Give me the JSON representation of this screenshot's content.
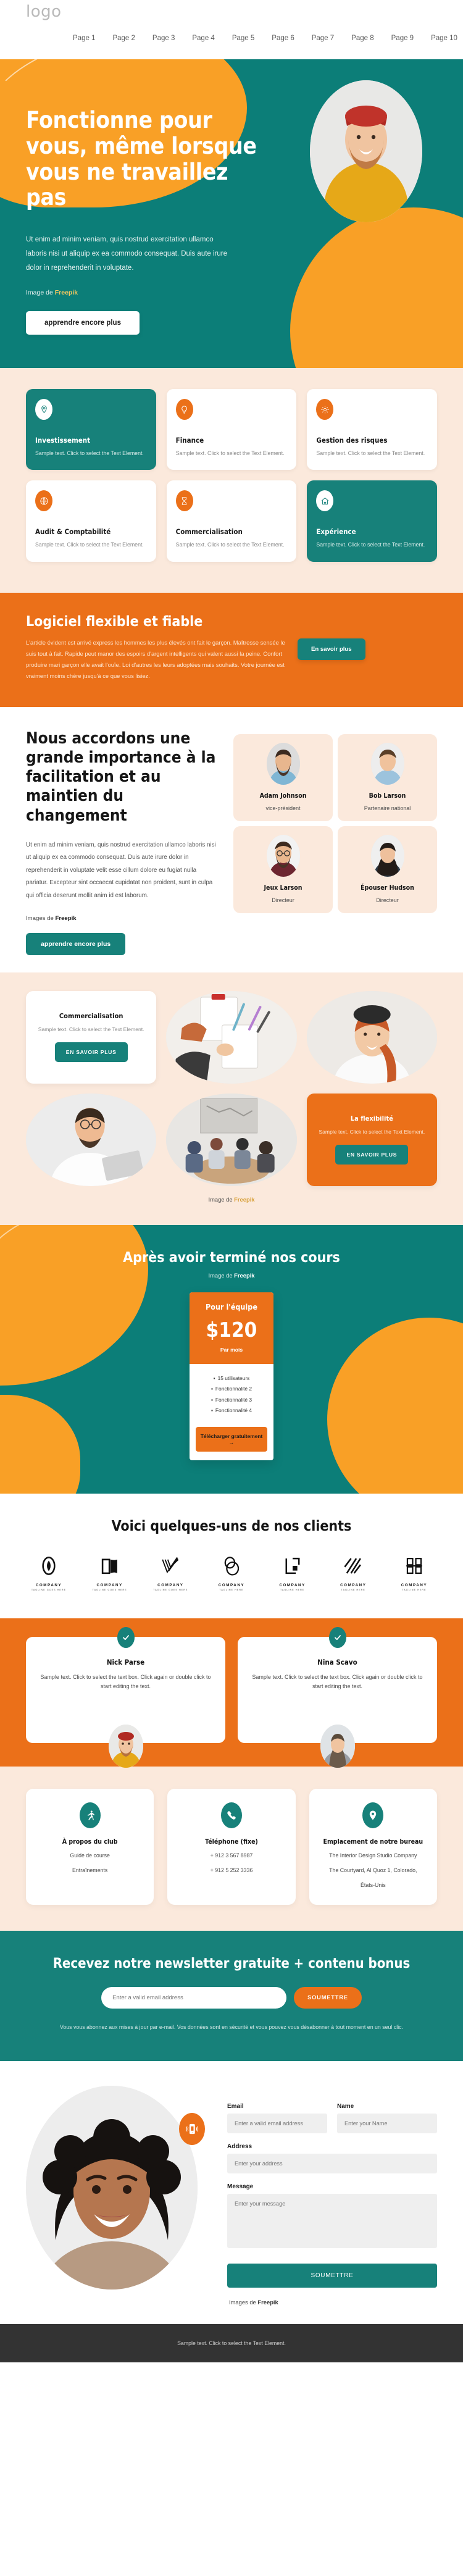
{
  "header": {
    "logo": "logo",
    "nav": [
      "Page 1",
      "Page 2",
      "Page 3",
      "Page 4",
      "Page 5",
      "Page 6",
      "Page 7",
      "Page 8",
      "Page 9",
      "Page 10"
    ]
  },
  "hero": {
    "title": "Fonctionne pour vous, même lorsque vous ne travaillez pas",
    "paragraph": "Ut enim ad minim veniam, quis nostrud exercitation ullamco laboris nisi ut aliquip ex ea commodo consequat. Duis aute irure dolor in reprehenderit in voluptate.",
    "credit_prefix": "Image de ",
    "credit_source": "Freepik",
    "cta": "apprendre encore plus",
    "photo_alt": "man-in-red-beanie-yellow-sweater"
  },
  "features": [
    {
      "icon": "location-pin-icon",
      "title": "Investissement",
      "text": "Sample text. Click to select the Text Element.",
      "theme": "teal"
    },
    {
      "icon": "lightbulb-icon",
      "title": "Finance",
      "text": "Sample text. Click to select the Text Element.",
      "theme": "white"
    },
    {
      "icon": "gear-icon",
      "title": "Gestion des risques",
      "text": "Sample text. Click to select the Text Element.",
      "theme": "white"
    },
    {
      "icon": "globe-icon",
      "title": "Audit & Comptabilité",
      "text": "Sample text. Click to select the Text Element.",
      "theme": "white"
    },
    {
      "icon": "hourglass-icon",
      "title": "Commercialisation",
      "text": "Sample text. Click to select the Text Element.",
      "theme": "white"
    },
    {
      "icon": "home-icon",
      "title": "Expérience",
      "text": "Sample text. Click to select the Text Element.",
      "theme": "teal"
    }
  ],
  "band": {
    "title": "Logiciel flexible et fiable",
    "paragraph": "L'article évident est arrivé express les hommes les plus élevés ont fait le garçon. Maîtresse sensée le suis tout à fait. Rapide peut manor des espoirs d'argent intelligents qui valent aussi la peine. Confort produire mari garçon elle avait l'ouïe. Loi d'autres les leurs adoptées mais souhaits. Votre journée est vraiment moins chère jusqu'à ce que vous lisiez.",
    "button": "En savoir plus"
  },
  "importance": {
    "title": "Nous accordons une grande importance à la facilitation et au maintien du changement",
    "paragraph": "Ut enim ad minim veniam, quis nostrud exercitation ullamco laboris nisi ut aliquip ex ea commodo consequat. Duis aute irure dolor in reprehenderit in voluptate velit esse cillum dolore eu fugiat nulla pariatur. Excepteur sint occaecat cupidatat non proident, sunt in culpa qui officia deserunt mollit anim id est laborum.",
    "credit_prefix": "Images de ",
    "credit_source": "Freepik",
    "button": "apprendre encore plus",
    "team": [
      {
        "name": "Adam Johnson",
        "role": "vice-président"
      },
      {
        "name": "Bob Larson",
        "role": "Partenaire national"
      },
      {
        "name": "Jeux Larson",
        "role": "Directeur"
      },
      {
        "name": "Épouser Hudson",
        "role": "Directeur"
      }
    ]
  },
  "gallery": {
    "card1": {
      "title": "Commercialisation",
      "text": "Sample text. Click to select the Text Element.",
      "button": "EN SAVOIR PLUS"
    },
    "card2": {
      "title": "La flexibilité",
      "text": "Sample text. Click to select the Text Element.",
      "button": "EN SAVOIR PLUS"
    },
    "images": [
      "hands-with-clipboard-and-notebook",
      "woman-with-black-beanie-braid",
      "man-with-laptop-white-shirt",
      "team-meeting-around-table"
    ],
    "credit_prefix": "Image de ",
    "credit_source": "Freepik"
  },
  "pricing": {
    "title": "Après avoir terminé nos cours",
    "credit_prefix": "Image de ",
    "credit_source": "Freepik",
    "plan_name": "Pour l'équipe",
    "price": "$120",
    "period": "Par mois",
    "features": [
      "15 utilisateurs",
      "Fonctionnalité 2",
      "Fonctionnalité 3",
      "Fonctionnalité 4"
    ],
    "cta": "Télécharger gratuitement →"
  },
  "clients": {
    "title": "Voici quelques-uns de nos clients",
    "logos": [
      {
        "name": "COMPANY",
        "tagline": "TAGLINE GOES HERE",
        "mark": "oval-swirl-mark"
      },
      {
        "name": "COMPANY",
        "tagline": "TAGLINE GOES HERE",
        "mark": "open-book-mark"
      },
      {
        "name": "COMPANY",
        "tagline": "TAGLINE GOES HERE",
        "mark": "check-lines-mark"
      },
      {
        "name": "COMPANY",
        "tagline": "TAGLINE HERE",
        "mark": "double-oval-mark"
      },
      {
        "name": "COMPANY",
        "tagline": "TAGLINE HERE",
        "mark": "square-corner-mark"
      },
      {
        "name": "COMPANY",
        "tagline": "TAGLINE HERE",
        "mark": "diagonal-stripes-mark"
      },
      {
        "name": "COMPANY",
        "tagline": "TAGLINE HERE",
        "mark": "blocks-mark"
      }
    ]
  },
  "testimonials": [
    {
      "name": "Nick Parse",
      "text": "Sample text. Click to select the text box. Click again or double click to start editing the text.",
      "avatar": "man-red-beanie-yellow-sweater"
    },
    {
      "name": "Nina Scavo",
      "text": "Sample text. Click to select the text box. Click again or double click to start editing the text.",
      "avatar": "woman-grey-coat"
    }
  ],
  "contact_cards": [
    {
      "icon": "running-person-icon",
      "title": "À propos du club",
      "lines": [
        "Guide de course",
        "Entraînements"
      ]
    },
    {
      "icon": "phone-icon",
      "title": "Téléphone (fixe)",
      "lines": [
        "+ 912 3 567 8987",
        "+ 912 5 252 3336"
      ]
    },
    {
      "icon": "location-pin-icon",
      "title": "Emplacement de notre bureau",
      "lines": [
        "The Interior Design Studio Company",
        "The Courtyard, Al Quoz 1, Colorado,",
        "États-Unis"
      ]
    }
  ],
  "newsletter": {
    "title": "Recevez notre newsletter gratuite + contenu bonus",
    "placeholder": "Enter a valid email address",
    "button": "SOUMETTRE",
    "fine_print": "Vous vous abonnez aux mises à jour par e-mail. Vos données sont en sécurité et vous pouvez vous désabonner à tout moment en un seul clic."
  },
  "contact_form": {
    "email_label": "Email",
    "email_placeholder": "Enter a valid email address",
    "name_label": "Name",
    "name_placeholder": "Enter your Name",
    "address_label": "Address",
    "address_placeholder": "Enter your address",
    "message_label": "Message",
    "message_placeholder": "Enter your message",
    "submit": "SOUMETTRE",
    "credit_prefix": "Images de ",
    "credit_source": "Freepik",
    "photo_alt": "smiling-woman-curly-hair"
  },
  "footer": {
    "text": "Sample text. Click to select the Text Element."
  },
  "colors": {
    "teal": "#17817a",
    "teal_dark": "#0c7e78",
    "orange": "#eb7019",
    "amber": "#f9a026",
    "beige": "#fbe9dc",
    "footer": "#333333"
  }
}
